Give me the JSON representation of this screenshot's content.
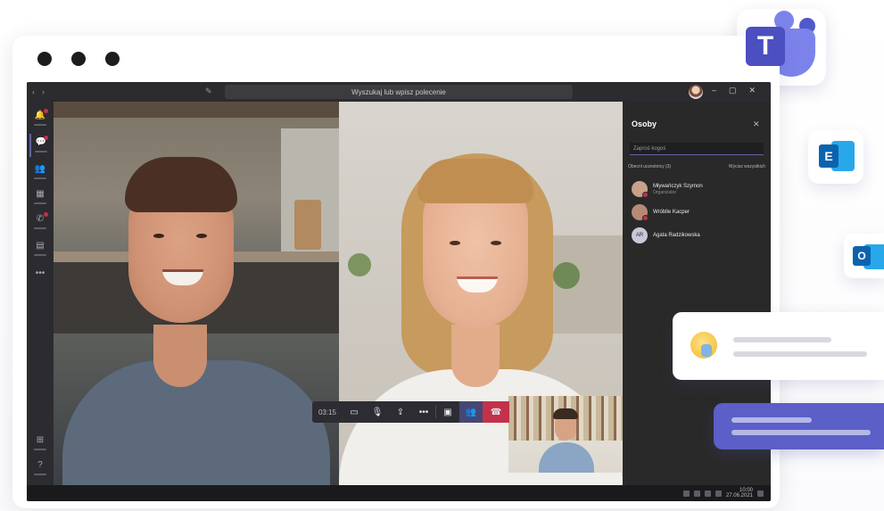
{
  "window": {
    "search_text": "Wyszukaj lub wpisz polecenie",
    "window_controls": [
      "–",
      "▢",
      "✕"
    ]
  },
  "rail": {
    "items": [
      {
        "icon": "bell-icon",
        "glyph": "🔔",
        "badge": true
      },
      {
        "icon": "chat-icon",
        "glyph": "💬",
        "badge": true,
        "active": true
      },
      {
        "icon": "teams-icon",
        "glyph": "👥",
        "badge": false
      },
      {
        "icon": "calendar-icon",
        "glyph": "▦",
        "badge": false
      },
      {
        "icon": "calls-icon",
        "glyph": "✆",
        "badge": true
      },
      {
        "icon": "files-icon",
        "glyph": "▤",
        "badge": false
      },
      {
        "icon": "more-icon",
        "glyph": "•••",
        "badge": false
      }
    ],
    "bottom": [
      {
        "icon": "apps-icon",
        "glyph": "⊞"
      },
      {
        "icon": "help-icon",
        "glyph": "?"
      }
    ]
  },
  "call_controls": {
    "time": "03:15",
    "camera": "▭",
    "mic": "🎙",
    "share": "⇪",
    "more": "•••",
    "chat": "▣",
    "people": "👥",
    "hangup": "☎"
  },
  "people_panel": {
    "title": "Osoby",
    "close": "✕",
    "search_placeholder": "Zaproś kogoś",
    "section_label": "Obecni uczestnicy (3)",
    "mute_all": "Wycisz wszystkich",
    "participants": [
      {
        "name": "Mływańczyk Szymon",
        "role": "Organizator",
        "avatar_color": "#c9a08a"
      },
      {
        "name": "Wróblle Kacper",
        "role": "",
        "avatar_color": "#b78a76"
      },
      {
        "name": "Agata Radzikowska",
        "role": "",
        "avatar_color": "#c8c8d8",
        "initials": "AR"
      }
    ]
  },
  "statusbar": {
    "clock_time": "10:00",
    "clock_date": "27.06.2021"
  },
  "apps": {
    "teams_letter": "T",
    "exchange_letter": "E",
    "outlook_letter": "O"
  },
  "colors": {
    "accent": "#6264a7",
    "hangup": "#c4314b",
    "teams_purple": "#5b5fc7"
  }
}
